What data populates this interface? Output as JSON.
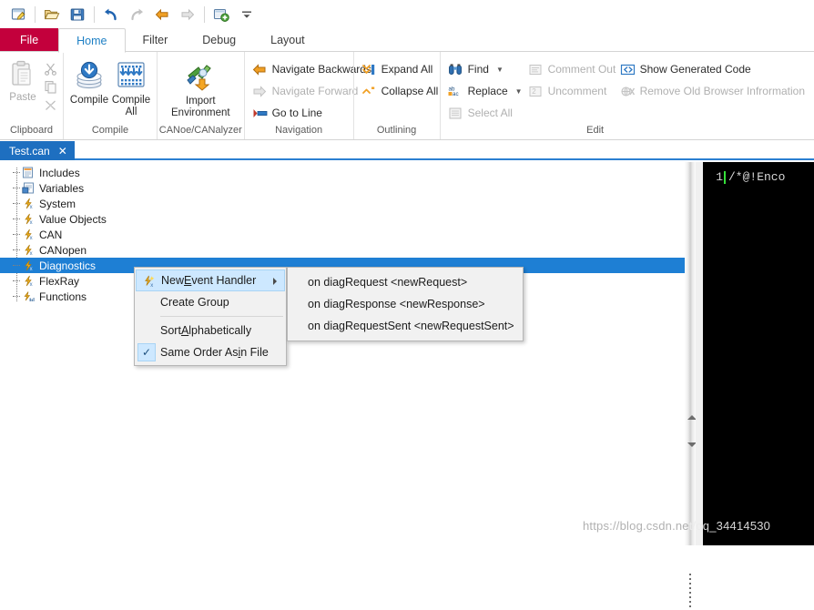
{
  "quick_access": {
    "buttons": [
      {
        "name": "new-file-icon",
        "title": "New"
      },
      {
        "name": "open-folder-icon",
        "title": "Open"
      },
      {
        "name": "save-icon",
        "title": "Save"
      },
      {
        "name": "undo-icon",
        "title": "Undo"
      },
      {
        "name": "redo-icon",
        "title": "Redo"
      },
      {
        "name": "navigate-back-icon",
        "title": "Back"
      },
      {
        "name": "navigate-forward-icon",
        "title": "Forward"
      },
      {
        "name": "add-window-icon",
        "title": "New Window"
      },
      {
        "name": "customize-toolbar-icon",
        "title": "Customize Quick Access Toolbar"
      }
    ]
  },
  "ribbon": {
    "tabs": [
      {
        "label": "File",
        "kind": "file"
      },
      {
        "label": "Home",
        "kind": "active"
      },
      {
        "label": "Filter",
        "kind": "normal"
      },
      {
        "label": "Debug",
        "kind": "normal"
      },
      {
        "label": "Layout",
        "kind": "normal"
      }
    ],
    "groups": {
      "clipboard": {
        "label": "Clipboard",
        "paste": "Paste",
        "cut_icon": "scissors-icon",
        "copy_icon": "copy-icon",
        "format_painter_icon": "format-painter-icon"
      },
      "compile": {
        "label": "Compile",
        "compile": "Compile",
        "compile_all_line1": "Compile",
        "compile_all_line2": "All"
      },
      "canoe": {
        "label": "CANoe/CANalyzer",
        "import_line1": "Import",
        "import_line2": "Environment"
      },
      "navigation": {
        "label": "Navigation",
        "items": [
          {
            "label": "Navigate Backwards",
            "icon": "arrow-left-icon",
            "disabled": false
          },
          {
            "label": "Navigate Forward",
            "icon": "arrow-right-icon",
            "disabled": true
          },
          {
            "label": "Go to Line",
            "icon": "goto-line-icon",
            "disabled": false
          }
        ]
      },
      "outlining": {
        "label": "Outlining",
        "items": [
          {
            "label": "Expand All",
            "icon": "expand-all-icon",
            "disabled": false
          },
          {
            "label": "Collapse All",
            "icon": "collapse-all-icon",
            "disabled": false
          }
        ]
      },
      "edit": {
        "label": "Edit",
        "col1": [
          {
            "label": "Find",
            "icon": "binoculars-icon",
            "disabled": false,
            "caret": true
          },
          {
            "label": "Replace",
            "icon": "replace-icon",
            "disabled": false,
            "caret": true
          },
          {
            "label": "Select All",
            "icon": "select-all-icon",
            "disabled": true,
            "caret": false
          }
        ],
        "col2": [
          {
            "label": "Comment Out",
            "icon": "comment-out-icon",
            "disabled": true,
            "caret": false
          },
          {
            "label": "Uncomment",
            "icon": "uncomment-icon",
            "disabled": true,
            "caret": false
          }
        ],
        "col3": [
          {
            "label": "Show Generated Code",
            "icon": "show-generated-code-icon",
            "disabled": false,
            "caret": false
          },
          {
            "label": "Remove Old Browser Infrormation",
            "icon": "remove-browser-info-icon",
            "disabled": true,
            "caret": false
          }
        ]
      }
    }
  },
  "document_tabs": [
    {
      "label": "Test.can",
      "close": "✕",
      "active": true
    }
  ],
  "tree": {
    "items": [
      {
        "label": "Includes",
        "icon": "includes-icon",
        "selected": false
      },
      {
        "label": "Variables",
        "icon": "variables-icon",
        "selected": false
      },
      {
        "label": "System",
        "icon": "function-icon",
        "selected": false
      },
      {
        "label": "Value Objects",
        "icon": "function-icon",
        "selected": false
      },
      {
        "label": "CAN",
        "icon": "function-icon",
        "selected": false
      },
      {
        "label": "CANopen",
        "icon": "function-icon",
        "selected": false
      },
      {
        "label": "Diagnostics",
        "icon": "function-icon",
        "selected": true
      },
      {
        "label": "FlexRay",
        "icon": "function-icon",
        "selected": false
      },
      {
        "label": "Functions",
        "icon": "functions-icon",
        "selected": false
      }
    ]
  },
  "context_menu": {
    "items": [
      {
        "id": "new-event-handler",
        "pre": "New ",
        "accel": "E",
        "post": "vent Handler",
        "highlighted": true,
        "submenu": true,
        "icon": "event-handler-icon",
        "checked": false
      },
      {
        "id": "create-group",
        "pre": "Create Group",
        "accel": "",
        "post": "",
        "highlighted": false,
        "submenu": false,
        "icon": "",
        "checked": false
      },
      {
        "id": "sort-alphabetically",
        "pre": "Sort ",
        "accel": "A",
        "post": "lphabetically",
        "highlighted": false,
        "submenu": false,
        "icon": "",
        "checked": false
      },
      {
        "id": "same-order-as-in-file",
        "pre": "Same Order As ",
        "accel": "i",
        "post": "n File",
        "highlighted": false,
        "submenu": false,
        "icon": "",
        "checked": true,
        "check_glyph": "✓"
      }
    ]
  },
  "submenu": {
    "items": [
      {
        "label": "on diagRequest <newRequest>"
      },
      {
        "label": "on diagResponse <newResponse>"
      },
      {
        "label": "on diagRequestSent <newRequestSent>"
      }
    ]
  },
  "editor": {
    "line_number": "1",
    "code": "/*@!Enco",
    "background": "#000000",
    "caret_color": "#35e03a"
  },
  "watermark": {
    "text_light": "https://blog.csdn.ne",
    "text_dark": "t/qq_34414530"
  },
  "colors": {
    "file_tab": "#c3003c",
    "active_tab_text": "#1d7fc4",
    "selection": "#1e7fd4",
    "doc_tab": "#1e6fc0"
  }
}
